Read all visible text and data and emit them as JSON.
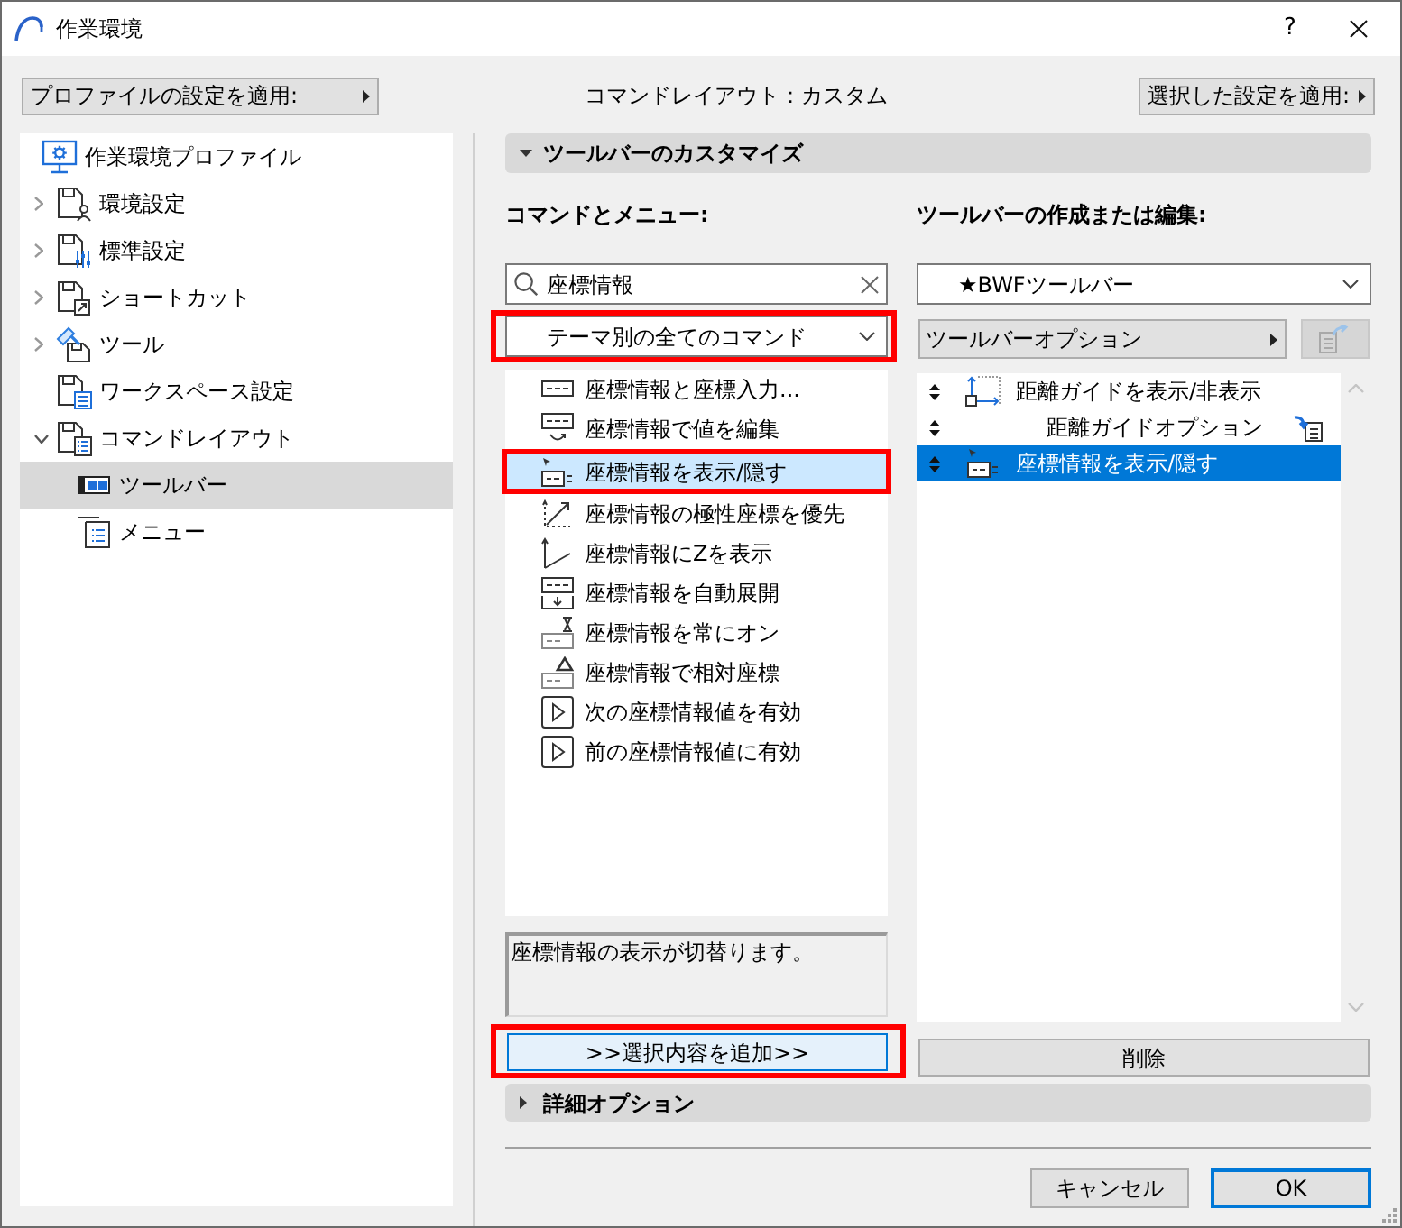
{
  "window": {
    "title": "作業環境",
    "help_button": "?"
  },
  "header": {
    "apply_profile_button": "プロファイルの設定を適用:",
    "layout_status": "コマンドレイアウト：カスタム",
    "apply_selected_button": "選択した設定を適用:"
  },
  "tree": [
    {
      "label": "作業環境プロファイル",
      "selected": false,
      "children": [
        {
          "label": "環境設定",
          "expanded": false,
          "selected": false
        },
        {
          "label": "標準設定",
          "expanded": false,
          "selected": false
        },
        {
          "label": "ショートカット",
          "expanded": false,
          "selected": false
        },
        {
          "label": "ツール",
          "expanded": false,
          "selected": false
        },
        {
          "label": "ワークスペース設定",
          "selected": false
        },
        {
          "label": "コマンドレイアウト",
          "expanded": true,
          "selected": false,
          "children": [
            {
              "label": "ツールバー",
              "selected": true
            },
            {
              "label": "メニュー",
              "selected": false
            }
          ]
        }
      ]
    }
  ],
  "customize_section": {
    "title": "ツールバーのカスタマイズ",
    "expanded": true
  },
  "commands": {
    "label": "コマンドとメニュー:",
    "search": {
      "value": "座標情報"
    },
    "category": {
      "value": "テーマ別の全てのコマンド",
      "annotated": true
    },
    "items": [
      {
        "label": "座標情報と座標入力...",
        "selected": false,
        "annotated": false
      },
      {
        "label": "座標情報で値を編集",
        "selected": false,
        "annotated": false
      },
      {
        "label": "座標情報を表示/隠す",
        "selected": true,
        "annotated": true
      },
      {
        "label": "座標情報の極性座標を優先",
        "selected": false,
        "annotated": false
      },
      {
        "label": "座標情報にZを表示",
        "selected": false,
        "annotated": false
      },
      {
        "label": "座標情報を自動展開",
        "selected": false,
        "annotated": false
      },
      {
        "label": "座標情報を常にオン",
        "selected": false,
        "annotated": false
      },
      {
        "label": "座標情報で相対座標",
        "selected": false,
        "annotated": false
      },
      {
        "label": "次の座標情報値を有効",
        "selected": false,
        "annotated": false
      },
      {
        "label": "前の座標情報値に有効",
        "selected": false,
        "annotated": false
      }
    ],
    "description": "座標情報の表示が切替ります。",
    "add_button": {
      "label": ">>選択内容を追加>>",
      "annotated": true
    }
  },
  "toolbar": {
    "label": "ツールバーの作成または編集:",
    "toolbar_select": {
      "value": "★BWFツールバー"
    },
    "options_button": "ツールバーオプション",
    "export_button": {
      "disabled": true
    },
    "items": [
      {
        "kind": "command",
        "label": "距離ガイドを表示/非表示",
        "selected": false
      },
      {
        "kind": "option",
        "label": "距離ガイドオプション",
        "selected": false
      },
      {
        "kind": "command",
        "label": "座標情報を表示/隠す",
        "selected": true
      }
    ],
    "delete_button": "削除"
  },
  "advanced_section": {
    "title": "詳細オプション",
    "expanded": false
  },
  "footer_buttons": [
    {
      "label": "キャンセル",
      "default": false
    },
    {
      "label": "OK",
      "default": true
    }
  ]
}
